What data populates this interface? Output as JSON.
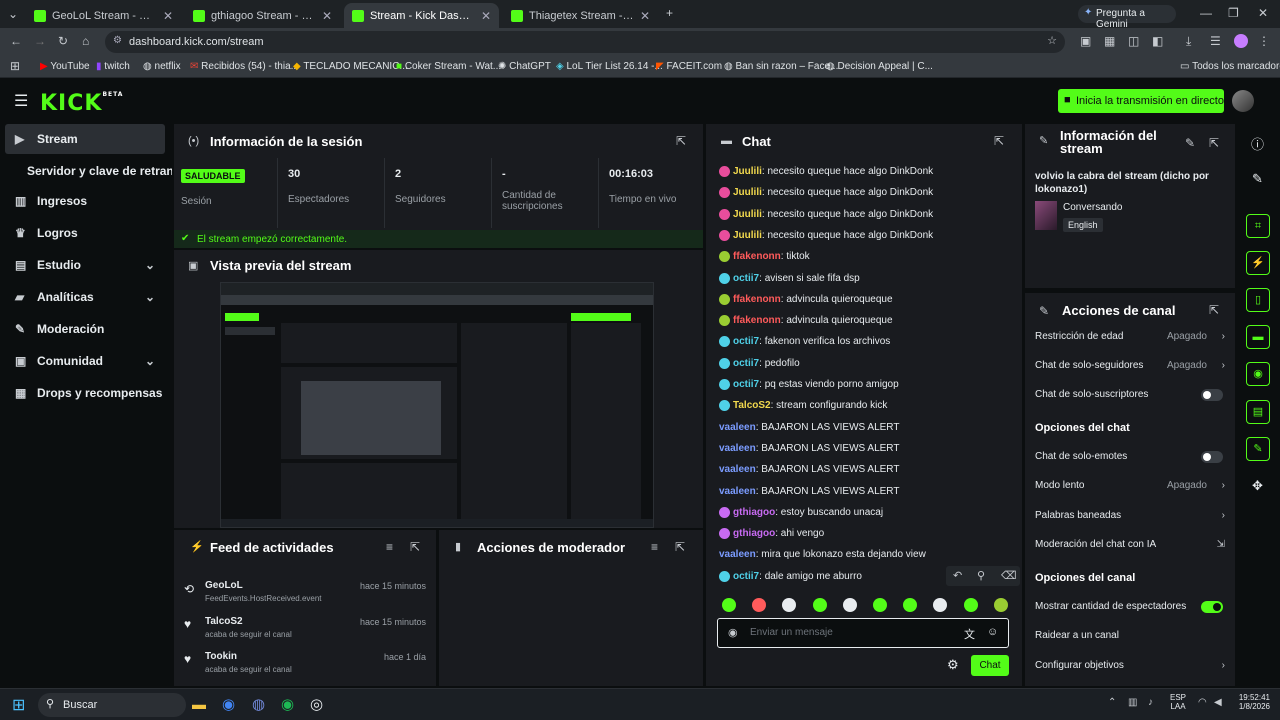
{
  "browser": {
    "tabs": [
      {
        "label": "GeoLoL Stream - Watch Live on",
        "active": false
      },
      {
        "label": "gthiagoo Stream - Watch Live o",
        "active": false
      },
      {
        "label": "Stream - Kick Dashboard",
        "active": true
      },
      {
        "label": "Thiagetex Stream - Watch Live o",
        "active": false
      }
    ],
    "gemini": "Pregunta a Gemini",
    "url": "dashboard.kick.com/stream",
    "bookmarks": [
      "YouTube",
      "twitch",
      "netflix",
      "Recibidos (54) - thia...",
      "TECLADO MECANIC...",
      "Coker Stream - Wat...",
      "ChatGPT",
      "LoL Tier List 26.14 -...",
      "FACEIT.com",
      "Ban sin razon – Face...",
      "Decision Appeal | C..."
    ],
    "bookmarks_all": "Todos los marcadores"
  },
  "header": {
    "logo": "KICK",
    "logo_sup": "BETA",
    "go_live": "Inicia la transmisión en directo"
  },
  "sidebar": {
    "items": [
      {
        "label": "Stream",
        "icon": "stream-icon",
        "active": true
      },
      {
        "label": "Servidor y clave de retransmi",
        "icon": "",
        "active": false
      },
      {
        "label": "Ingresos",
        "icon": "revenue-icon"
      },
      {
        "label": "Logros",
        "icon": "trophy-icon"
      },
      {
        "label": "Estudio",
        "icon": "studio-icon",
        "chevron": true
      },
      {
        "label": "Analíticas",
        "icon": "analytics-icon",
        "chevron": true
      },
      {
        "label": "Moderación",
        "icon": "wrench-icon"
      },
      {
        "label": "Comunidad",
        "icon": "community-icon",
        "chevron": true
      },
      {
        "label": "Drops y recompensas",
        "icon": "drops-icon"
      }
    ]
  },
  "session": {
    "title": "Información de la sesión",
    "status_badge": "SALUDABLE",
    "status_label": "Sesión",
    "stats": [
      {
        "value": "30",
        "label": "Espectadores"
      },
      {
        "value": "2",
        "label": "Seguidores"
      },
      {
        "value": "-",
        "label": "Cantidad de suscripciones"
      },
      {
        "value": "00:16:03",
        "label": "Tiempo en vivo"
      }
    ],
    "notice": "El stream empezó correctamente."
  },
  "preview": {
    "title": "Vista previa del stream"
  },
  "feed": {
    "title": "Feed de actividades",
    "items": [
      {
        "name": "GeoLoL",
        "sub": "FeedEvents.HostReceived.event",
        "time": "hace 15 minutos",
        "icon": "host-icon"
      },
      {
        "name": "TalcoS2",
        "sub": "acaba de seguir el canal",
        "time": "hace 15 minutos",
        "icon": "heart-icon"
      },
      {
        "name": "Tookin",
        "sub": "acaba de seguir el canal",
        "time": "hace 1 día",
        "icon": "heart-icon"
      }
    ]
  },
  "moderator": {
    "title": "Acciones de moderador"
  },
  "chat": {
    "title": "Chat",
    "messages": [
      {
        "user": "Juulili",
        "color": "#f2d94e",
        "badge": "#e84d9c",
        "text": "necesito queque hace algo DinkDonk"
      },
      {
        "user": "Juulili",
        "color": "#f2d94e",
        "badge": "#e84d9c",
        "text": "necesito queque hace algo DinkDonk"
      },
      {
        "user": "Juulili",
        "color": "#f2d94e",
        "badge": "#e84d9c",
        "text": "necesito queque hace algo DinkDonk"
      },
      {
        "user": "Juulili",
        "color": "#f2d94e",
        "badge": "#e84d9c",
        "text": "necesito queque hace algo DinkDonk"
      },
      {
        "user": "ffakenonn",
        "color": "#ff5b5b",
        "badge": "#9acd32",
        "text": "tiktok"
      },
      {
        "user": "octii7",
        "color": "#4fd1e8",
        "badge": "#4fd1e8",
        "text": "avisen si sale fifa dsp"
      },
      {
        "user": "ffakenonn",
        "color": "#ff5b5b",
        "badge": "#9acd32",
        "text": "advincula quieroqueque"
      },
      {
        "user": "ffakenonn",
        "color": "#ff5b5b",
        "badge": "#9acd32",
        "text": "advincula quieroqueque"
      },
      {
        "user": "octii7",
        "color": "#4fd1e8",
        "badge": "#4fd1e8",
        "text": "fakenon verifica los archivos"
      },
      {
        "user": "octii7",
        "color": "#4fd1e8",
        "badge": "#4fd1e8",
        "text": "pedofilo"
      },
      {
        "user": "octii7",
        "color": "#4fd1e8",
        "badge": "#4fd1e8",
        "text": "pq estas viendo porno amigop"
      },
      {
        "user": "TalcoS2",
        "color": "#f2d94e",
        "badge": "#4fd1e8",
        "text": "stream configurando kick"
      },
      {
        "user": "vaaleen",
        "color": "#7b9cff",
        "badge": "",
        "text": "BAJARON LAS VIEWS ALERT"
      },
      {
        "user": "vaaleen",
        "color": "#7b9cff",
        "badge": "",
        "text": "BAJARON LAS VIEWS ALERT"
      },
      {
        "user": "vaaleen",
        "color": "#7b9cff",
        "badge": "",
        "text": "BAJARON LAS VIEWS ALERT"
      },
      {
        "user": "vaaleen",
        "color": "#7b9cff",
        "badge": "",
        "text": "BAJARON LAS VIEWS ALERT"
      },
      {
        "user": "gthiagoo",
        "color": "#c86bf2",
        "badge": "#c86bf2",
        "text": "estoy buscando unacaj"
      },
      {
        "user": "gthiagoo",
        "color": "#c86bf2",
        "badge": "#c86bf2",
        "text": "ahi vengo"
      },
      {
        "user": "vaaleen",
        "color": "#7b9cff",
        "badge": "",
        "text": "mira que lokonazo esta dejando view"
      },
      {
        "user": "octii7",
        "color": "#4fd1e8",
        "badge": "#4fd1e8",
        "text": "dale amigo me aburro"
      }
    ],
    "input_placeholder": "Enviar un mensaje",
    "send_label": "Chat"
  },
  "stream_info": {
    "title": "Información del stream",
    "stream_title": "volvio la cabra del stream (dicho por lokonazo1)",
    "category": "Conversando",
    "language": "English"
  },
  "channel_actions": {
    "title": "Acciones de canal",
    "rows": [
      {
        "label": "Restricción de edad",
        "value": "Apagado",
        "type": "arrow"
      },
      {
        "label": "Chat de solo-seguidores",
        "value": "Apagado",
        "type": "arrow"
      },
      {
        "label": "Chat de solo-suscriptores",
        "type": "toggle",
        "on": false
      }
    ],
    "chat_options_title": "Opciones del chat",
    "chat_rows": [
      {
        "label": "Chat de solo-emotes",
        "type": "toggle",
        "on": false
      },
      {
        "label": "Modo lento",
        "value": "Apagado",
        "type": "arrow"
      },
      {
        "label": "Palabras baneadas",
        "type": "arrow"
      },
      {
        "label": "Moderación del chat con IA",
        "type": "ext"
      }
    ],
    "channel_options_title": "Opciones del canal",
    "channel_rows": [
      {
        "label": "Mostrar cantidad de espectadores",
        "type": "toggle",
        "on": true
      },
      {
        "label": "Raidear a un canal",
        "type": "none"
      },
      {
        "label": "Configurar objetivos",
        "type": "arrow"
      }
    ]
  },
  "taskbar": {
    "search": "Buscar",
    "lang": "ESP",
    "lang2": "LAA",
    "time": "19:52:41",
    "date": "1/8/2026"
  },
  "colors": {
    "accent": "#53fc18",
    "panel": "#191b1f",
    "bg": "#0b0e0f"
  }
}
